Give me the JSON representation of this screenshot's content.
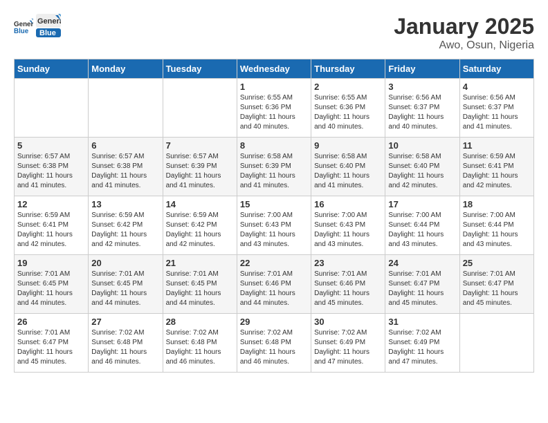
{
  "header": {
    "logo_line1": "General",
    "logo_line2": "Blue",
    "title": "January 2025",
    "subtitle": "Awo, Osun, Nigeria"
  },
  "days_of_week": [
    "Sunday",
    "Monday",
    "Tuesday",
    "Wednesday",
    "Thursday",
    "Friday",
    "Saturday"
  ],
  "weeks": [
    [
      {
        "day": "",
        "info": ""
      },
      {
        "day": "",
        "info": ""
      },
      {
        "day": "",
        "info": ""
      },
      {
        "day": "1",
        "info": "Sunrise: 6:55 AM\nSunset: 6:36 PM\nDaylight: 11 hours\nand 40 minutes."
      },
      {
        "day": "2",
        "info": "Sunrise: 6:55 AM\nSunset: 6:36 PM\nDaylight: 11 hours\nand 40 minutes."
      },
      {
        "day": "3",
        "info": "Sunrise: 6:56 AM\nSunset: 6:37 PM\nDaylight: 11 hours\nand 40 minutes."
      },
      {
        "day": "4",
        "info": "Sunrise: 6:56 AM\nSunset: 6:37 PM\nDaylight: 11 hours\nand 41 minutes."
      }
    ],
    [
      {
        "day": "5",
        "info": "Sunrise: 6:57 AM\nSunset: 6:38 PM\nDaylight: 11 hours\nand 41 minutes."
      },
      {
        "day": "6",
        "info": "Sunrise: 6:57 AM\nSunset: 6:38 PM\nDaylight: 11 hours\nand 41 minutes."
      },
      {
        "day": "7",
        "info": "Sunrise: 6:57 AM\nSunset: 6:39 PM\nDaylight: 11 hours\nand 41 minutes."
      },
      {
        "day": "8",
        "info": "Sunrise: 6:58 AM\nSunset: 6:39 PM\nDaylight: 11 hours\nand 41 minutes."
      },
      {
        "day": "9",
        "info": "Sunrise: 6:58 AM\nSunset: 6:40 PM\nDaylight: 11 hours\nand 41 minutes."
      },
      {
        "day": "10",
        "info": "Sunrise: 6:58 AM\nSunset: 6:40 PM\nDaylight: 11 hours\nand 42 minutes."
      },
      {
        "day": "11",
        "info": "Sunrise: 6:59 AM\nSunset: 6:41 PM\nDaylight: 11 hours\nand 42 minutes."
      }
    ],
    [
      {
        "day": "12",
        "info": "Sunrise: 6:59 AM\nSunset: 6:41 PM\nDaylight: 11 hours\nand 42 minutes."
      },
      {
        "day": "13",
        "info": "Sunrise: 6:59 AM\nSunset: 6:42 PM\nDaylight: 11 hours\nand 42 minutes."
      },
      {
        "day": "14",
        "info": "Sunrise: 6:59 AM\nSunset: 6:42 PM\nDaylight: 11 hours\nand 42 minutes."
      },
      {
        "day": "15",
        "info": "Sunrise: 7:00 AM\nSunset: 6:43 PM\nDaylight: 11 hours\nand 43 minutes."
      },
      {
        "day": "16",
        "info": "Sunrise: 7:00 AM\nSunset: 6:43 PM\nDaylight: 11 hours\nand 43 minutes."
      },
      {
        "day": "17",
        "info": "Sunrise: 7:00 AM\nSunset: 6:44 PM\nDaylight: 11 hours\nand 43 minutes."
      },
      {
        "day": "18",
        "info": "Sunrise: 7:00 AM\nSunset: 6:44 PM\nDaylight: 11 hours\nand 43 minutes."
      }
    ],
    [
      {
        "day": "19",
        "info": "Sunrise: 7:01 AM\nSunset: 6:45 PM\nDaylight: 11 hours\nand 44 minutes."
      },
      {
        "day": "20",
        "info": "Sunrise: 7:01 AM\nSunset: 6:45 PM\nDaylight: 11 hours\nand 44 minutes."
      },
      {
        "day": "21",
        "info": "Sunrise: 7:01 AM\nSunset: 6:45 PM\nDaylight: 11 hours\nand 44 minutes."
      },
      {
        "day": "22",
        "info": "Sunrise: 7:01 AM\nSunset: 6:46 PM\nDaylight: 11 hours\nand 44 minutes."
      },
      {
        "day": "23",
        "info": "Sunrise: 7:01 AM\nSunset: 6:46 PM\nDaylight: 11 hours\nand 45 minutes."
      },
      {
        "day": "24",
        "info": "Sunrise: 7:01 AM\nSunset: 6:47 PM\nDaylight: 11 hours\nand 45 minutes."
      },
      {
        "day": "25",
        "info": "Sunrise: 7:01 AM\nSunset: 6:47 PM\nDaylight: 11 hours\nand 45 minutes."
      }
    ],
    [
      {
        "day": "26",
        "info": "Sunrise: 7:01 AM\nSunset: 6:47 PM\nDaylight: 11 hours\nand 45 minutes."
      },
      {
        "day": "27",
        "info": "Sunrise: 7:02 AM\nSunset: 6:48 PM\nDaylight: 11 hours\nand 46 minutes."
      },
      {
        "day": "28",
        "info": "Sunrise: 7:02 AM\nSunset: 6:48 PM\nDaylight: 11 hours\nand 46 minutes."
      },
      {
        "day": "29",
        "info": "Sunrise: 7:02 AM\nSunset: 6:48 PM\nDaylight: 11 hours\nand 46 minutes."
      },
      {
        "day": "30",
        "info": "Sunrise: 7:02 AM\nSunset: 6:49 PM\nDaylight: 11 hours\nand 47 minutes."
      },
      {
        "day": "31",
        "info": "Sunrise: 7:02 AM\nSunset: 6:49 PM\nDaylight: 11 hours\nand 47 minutes."
      },
      {
        "day": "",
        "info": ""
      }
    ]
  ]
}
